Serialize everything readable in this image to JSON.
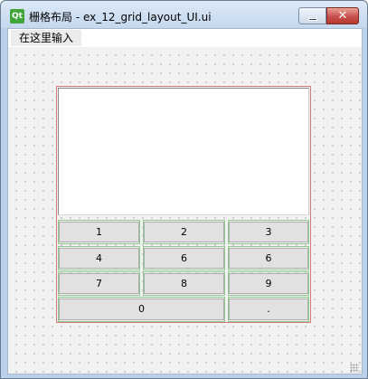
{
  "window": {
    "app_icon_text": "Qt",
    "title": "栅格布局 - ex_12_grid_layout_UI.ui",
    "close_glyph": "✕"
  },
  "menubar": {
    "placeholder_item": "在这里输入"
  },
  "keypad": {
    "row1": [
      "1",
      "2",
      "3"
    ],
    "row2": [
      "4",
      "6",
      "6"
    ],
    "row3": [
      "7",
      "8",
      "9"
    ],
    "row4": [
      "0",
      "."
    ]
  },
  "colors": {
    "layout_border": "#d37a7a",
    "cell_border": "#8fc98f",
    "button_face": "#e1e1e1"
  }
}
